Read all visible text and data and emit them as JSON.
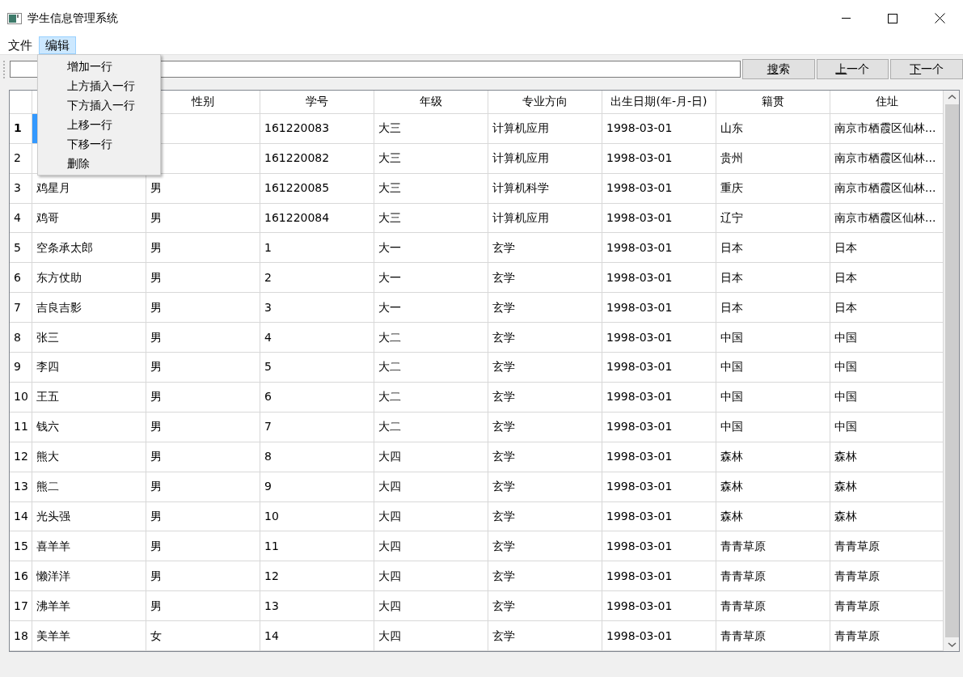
{
  "window": {
    "title": "学生信息管理系统"
  },
  "menu_bar": [
    {
      "label": "文件",
      "open": false
    },
    {
      "label": "编辑",
      "open": true
    }
  ],
  "edit_menu": [
    "增加一行",
    "上方插入一行",
    "下方插入一行",
    "上移一行",
    "下移一行",
    "删除"
  ],
  "toolbar": {
    "buttons": [
      "搜索",
      "上一个",
      "下一个"
    ]
  },
  "table": {
    "columns": [
      "性别",
      "学号",
      "年级",
      "专业方向",
      "出生日期(年-月-日)",
      "籍贯",
      "住址"
    ],
    "rows": [
      {
        "number": "1",
        "selected": true,
        "student_id": "161220083",
        "grade": "大三",
        "major": "计算机应用",
        "birth_date": "1998-03-01",
        "origin": "山东",
        "address": "南京市栖霞区仙林..."
      },
      {
        "number": "2",
        "selected": false,
        "student_id": "161220082",
        "grade": "大三",
        "major": "计算机应用",
        "birth_date": "1998-03-01",
        "origin": "贵州",
        "address": "南京市栖霞区仙林..."
      },
      {
        "number": "3",
        "selected": false,
        "name": "鸡星月",
        "gender": "男",
        "student_id": "161220085",
        "grade": "大三",
        "major": "计算机科学",
        "birth_date": "1998-03-01",
        "origin": "重庆",
        "address": "南京市栖霞区仙林..."
      },
      {
        "number": "4",
        "selected": false,
        "name": "鸡哥",
        "gender": "男",
        "student_id": "161220084",
        "grade": "大三",
        "major": "计算机应用",
        "birth_date": "1998-03-01",
        "origin": "辽宁",
        "address": "南京市栖霞区仙林..."
      },
      {
        "number": "5",
        "selected": false,
        "name": "空条承太郎",
        "gender": "男",
        "student_id": "1",
        "grade": "大一",
        "major": "玄学",
        "birth_date": "1998-03-01",
        "origin": "日本",
        "address": "日本"
      },
      {
        "number": "6",
        "selected": false,
        "name": "东方仗助",
        "gender": "男",
        "student_id": "2",
        "grade": "大一",
        "major": "玄学",
        "birth_date": "1998-03-01",
        "origin": "日本",
        "address": "日本"
      },
      {
        "number": "7",
        "selected": false,
        "name": "吉良吉影",
        "gender": "男",
        "student_id": "3",
        "grade": "大一",
        "major": "玄学",
        "birth_date": "1998-03-01",
        "origin": "日本",
        "address": "日本"
      },
      {
        "number": "8",
        "selected": false,
        "name": "张三",
        "gender": "男",
        "student_id": "4",
        "grade": "大二",
        "major": "玄学",
        "birth_date": "1998-03-01",
        "origin": "中国",
        "address": "中国"
      },
      {
        "number": "9",
        "selected": false,
        "name": "李四",
        "gender": "男",
        "student_id": "5",
        "grade": "大二",
        "major": "玄学",
        "birth_date": "1998-03-01",
        "origin": "中国",
        "address": "中国"
      },
      {
        "number": "10",
        "selected": false,
        "name": "王五",
        "gender": "男",
        "student_id": "6",
        "grade": "大二",
        "major": "玄学",
        "birth_date": "1998-03-01",
        "origin": "中国",
        "address": "中国"
      },
      {
        "number": "11",
        "selected": false,
        "name": "钱六",
        "gender": "男",
        "student_id": "7",
        "grade": "大二",
        "major": "玄学",
        "birth_date": "1998-03-01",
        "origin": "中国",
        "address": "中国"
      },
      {
        "number": "12",
        "selected": false,
        "name": "熊大",
        "gender": "男",
        "student_id": "8",
        "grade": "大四",
        "major": "玄学",
        "birth_date": "1998-03-01",
        "origin": "森林",
        "address": "森林"
      },
      {
        "number": "13",
        "selected": false,
        "name": "熊二",
        "gender": "男",
        "student_id": "9",
        "grade": "大四",
        "major": "玄学",
        "birth_date": "1998-03-01",
        "origin": "森林",
        "address": "森林"
      },
      {
        "number": "14",
        "selected": false,
        "name": "光头强",
        "gender": "男",
        "student_id": "10",
        "grade": "大四",
        "major": "玄学",
        "birth_date": "1998-03-01",
        "origin": "森林",
        "address": "森林"
      },
      {
        "number": "15",
        "selected": false,
        "name": "喜羊羊",
        "gender": "男",
        "student_id": "11",
        "grade": "大四",
        "major": "玄学",
        "birth_date": "1998-03-01",
        "origin": "青青草原",
        "address": "青青草原"
      },
      {
        "number": "16",
        "selected": false,
        "name": "懒洋洋",
        "gender": "男",
        "student_id": "12",
        "grade": "大四",
        "major": "玄学",
        "birth_date": "1998-03-01",
        "origin": "青青草原",
        "address": "青青草原"
      },
      {
        "number": "17",
        "selected": false,
        "name": "沸羊羊",
        "gender": "男",
        "student_id": "13",
        "grade": "大四",
        "major": "玄学",
        "birth_date": "1998-03-01",
        "origin": "青青草原",
        "address": "青青草原"
      },
      {
        "number": "18",
        "selected": false,
        "name": "美羊羊",
        "gender": "女",
        "student_id": "14",
        "grade": "大四",
        "major": "玄学",
        "birth_date": "1998-03-01",
        "origin": "青青草原",
        "address": "青青草原"
      }
    ]
  }
}
